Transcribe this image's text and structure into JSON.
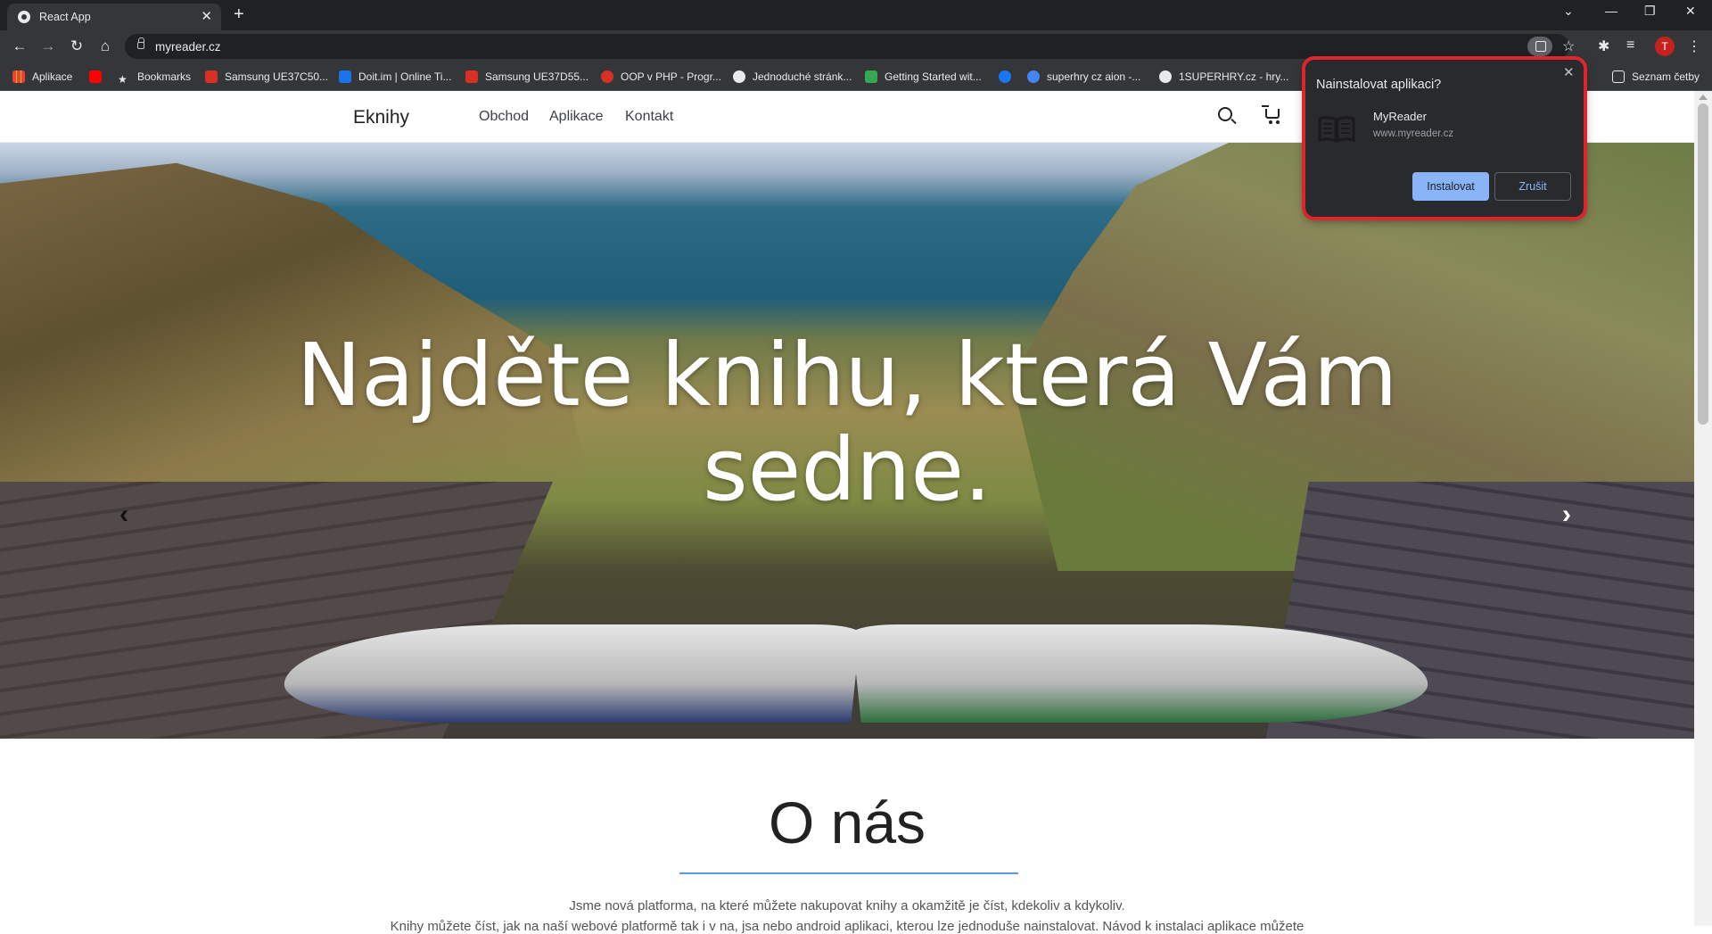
{
  "browser": {
    "tab_title": "React App",
    "url": "myreader.cz",
    "profile_initial": "T",
    "bookmarks": [
      {
        "label": "Aplikace",
        "color": "#ea4335"
      },
      {
        "label": "Bookmarks",
        "color": "#e8eaed"
      },
      {
        "label": "Samsung UE37C50...",
        "color": "#d93025"
      },
      {
        "label": "Doit.im | Online Ti...",
        "color": "#1a73e8"
      },
      {
        "label": "Samsung UE37D55...",
        "color": "#d93025"
      },
      {
        "label": "OOP v PHP - Progr...",
        "color": "#d93025"
      },
      {
        "label": "Jednoduché stránk...",
        "color": "#e8eaed"
      },
      {
        "label": "Getting Started wit...",
        "color": "#34a853"
      },
      {
        "label": "superhry cz aion -...",
        "color": "#4285f4"
      },
      {
        "label": "1SUPERHRY.cz - hry...",
        "color": "#e8eaed"
      },
      {
        "label": "Seznam četby",
        "color": "#e8eaed"
      }
    ]
  },
  "site": {
    "brand": "Eknihy",
    "nav": [
      "Obchod",
      "Aplikace",
      "Kontakt"
    ],
    "hero_headline": "Najděte knihu, která Vám sedne.",
    "about_title": "O nás",
    "about_text1": "Jsme nová platforma, na které můžete nakupovat knihy a okamžitě je číst, kdekoliv a kdykoliv.",
    "about_text2": "Knihy můžete číst, jak na naší webové platformě tak i v na, jsa nebo android aplikaci, kterou lze jednoduše nainstalovat. Návod k instalaci aplikace můžete"
  },
  "install_prompt": {
    "title": "Nainstalovat aplikaci?",
    "app_name": "MyReader",
    "app_url": "www.myreader.cz",
    "install_label": "Instalovat",
    "cancel_label": "Zrušit"
  },
  "colors": {
    "highlight": "#e0242b",
    "primary_button": "#8ab4f8"
  }
}
